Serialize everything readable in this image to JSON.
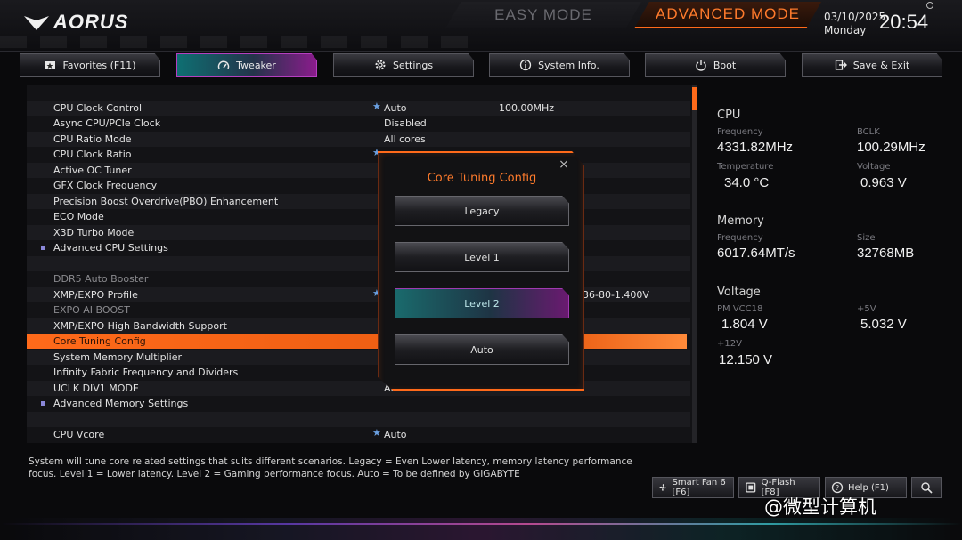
{
  "header": {
    "logo_text": "AORUS",
    "easy_mode": "EASY MODE",
    "advanced_mode": "ADVANCED MODE",
    "date": "03/10/2025",
    "weekday": "Monday",
    "time": "20:54"
  },
  "tabs": [
    {
      "label": "Favorites (F11)",
      "icon": "folder-star-icon"
    },
    {
      "label": "Tweaker",
      "icon": "speedometer-icon"
    },
    {
      "label": "Settings",
      "icon": "gear-icon"
    },
    {
      "label": "System Info.",
      "icon": "info-icon"
    },
    {
      "label": "Boot",
      "icon": "power-icon"
    },
    {
      "label": "Save & Exit",
      "icon": "exit-icon"
    }
  ],
  "settings": [
    {
      "label": "CPU Clock Control",
      "star": "★",
      "value": "Auto",
      "value2": "100.00MHz"
    },
    {
      "label": "Async CPU/PCIe Clock",
      "value": "Disabled"
    },
    {
      "label": "CPU Ratio Mode",
      "value": "All cores"
    },
    {
      "label": "CPU Clock Ratio",
      "star": "★"
    },
    {
      "label": "Active OC Tuner"
    },
    {
      "label": "GFX Clock Frequency"
    },
    {
      "label": "Precision Boost Overdrive(PBO) Enhancement"
    },
    {
      "label": "ECO Mode"
    },
    {
      "label": "X3D Turbo Mode"
    },
    {
      "label": "Advanced CPU Settings"
    },
    {
      "label": ""
    },
    {
      "label": "DDR5 Auto Booster"
    },
    {
      "label": "XMP/EXPO Profile",
      "star": "★",
      "value3": "36-80-1.400V"
    },
    {
      "label": "EXPO AI BOOST"
    },
    {
      "label": "XMP/EXPO High Bandwidth Support"
    },
    {
      "label": "Core Tuning Config"
    },
    {
      "label": "System Memory Multiplier"
    },
    {
      "label": "Infinity Fabric Frequency and Dividers"
    },
    {
      "label": "UCLK DIV1 MODE",
      "value": "Auto"
    },
    {
      "label": "Advanced Memory Settings"
    },
    {
      "label": ""
    },
    {
      "label": "CPU Vcore",
      "star": "★",
      "value": "Auto"
    }
  ],
  "hw_monitor": {
    "cpu": {
      "title": "CPU",
      "freq_label": "Frequency",
      "freq": "4331.82MHz",
      "bclk_label": "BCLK",
      "bclk": "100.29MHz",
      "temp_label": "Temperature",
      "temp": "34.0 °C",
      "volt_label": "Voltage",
      "volt": "0.963 V"
    },
    "memory": {
      "title": "Memory",
      "freq_label": "Frequency",
      "freq": "6017.64MT/s",
      "size_label": "Size",
      "size": "32768MB"
    },
    "voltage": {
      "title": "Voltage",
      "pm_label": "PM VCC18",
      "pm": "1.804 V",
      "v5_label": "+5V",
      "v5": "5.032 V",
      "v12_label": "+12V",
      "v12": "12.150 V"
    }
  },
  "modal": {
    "title": "Core Tuning Config",
    "close": "×",
    "options": [
      "Legacy",
      "Level 1",
      "Level 2",
      "Auto"
    ],
    "selected_index": 2
  },
  "help_text": "System will tune core related settings that suits different scenarios. Legacy = Even Lower latency, memory latency performance focus. Level 1 = Lower latency. Level 2 = Gaming performance focus. Auto = To be defined by GIGABYTE",
  "bottom": {
    "smart_fan": "Smart Fan 6 [F6]",
    "qflash": "Q-Flash [F8]",
    "help": "Help (F1)",
    "watermark": "@微型计算机"
  },
  "colors": {
    "accent_orange": "#ff6a1a",
    "accent_teal": "#1a6a6c",
    "accent_purple": "#8a1c8c"
  }
}
